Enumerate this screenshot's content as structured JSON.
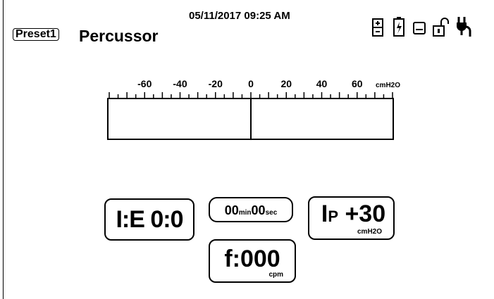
{
  "header": {
    "preset_label": "Preset1",
    "mode_title": "Percussor",
    "datetime": "05/11/2017 09:25 AM"
  },
  "status_icons": [
    "battery-full-icon",
    "battery-charging-icon",
    "save-icon",
    "unlock-icon",
    "power-plug-icon"
  ],
  "gauge": {
    "unit": "cmH2O",
    "tick_labels": [
      "-60",
      "-40",
      "-20",
      "0",
      "20",
      "40",
      "60"
    ]
  },
  "panels": {
    "ie_ratio": "I:E 0:0",
    "timer_min": "00",
    "timer_min_unit": "min",
    "timer_sec": "00",
    "timer_sec_unit": "sec",
    "ip_prefix": "I",
    "ip_sub": "P",
    "ip_value": "+30",
    "ip_unit": "cmH2O",
    "frequency": "f:000",
    "frequency_unit": "cpm"
  }
}
